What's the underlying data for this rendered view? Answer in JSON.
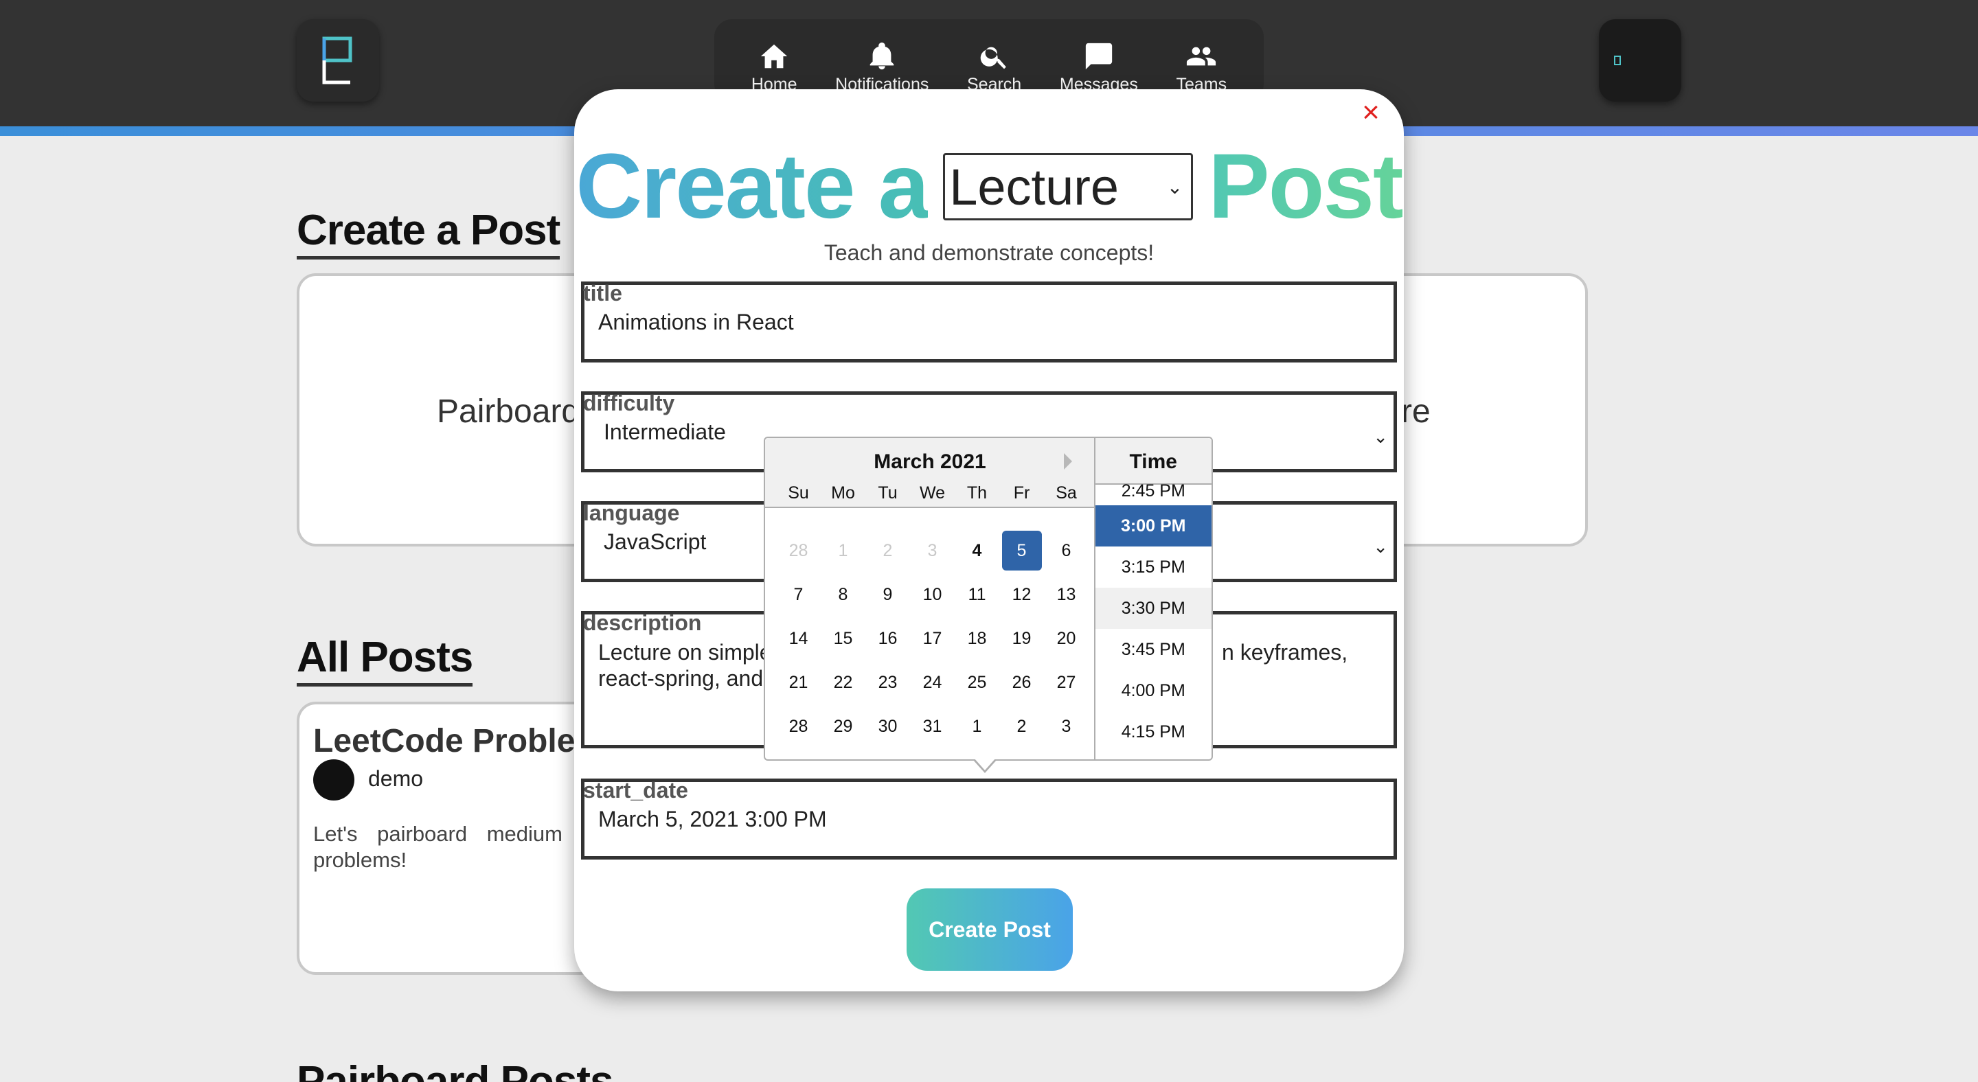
{
  "nav": {
    "items": [
      {
        "label": "Home",
        "icon": "home-icon"
      },
      {
        "label": "Notifications",
        "icon": "bell-icon"
      },
      {
        "label": "Search",
        "icon": "search-icon"
      },
      {
        "label": "Messages",
        "icon": "chat-icon"
      },
      {
        "label": "Teams",
        "icon": "people-icon"
      }
    ]
  },
  "page": {
    "create_title": "Create a Post",
    "choice_left": "Pairboard",
    "choice_right_fragment": "re",
    "all_posts_title": "All Posts",
    "pairboard_posts_title": "Pairboard Posts",
    "post_card": {
      "title": "LeetCode Problem",
      "user": "demo",
      "description": "Let's pairboard medium LeetCode problems!"
    }
  },
  "modal": {
    "close": "×",
    "title_prefix": "Create a",
    "post_type": "Lecture",
    "title_suffix": "Post",
    "subtitle": "Teach and demonstrate concepts!",
    "fields": {
      "title": {
        "label": "title",
        "value": "Animations in React"
      },
      "difficulty": {
        "label": "difficulty",
        "value": "Intermediate"
      },
      "language": {
        "label": "language",
        "value": "JavaScript"
      },
      "description": {
        "label": "description",
        "line1a": "Lecture on simple",
        "line1b": "n keyframes,",
        "line2a": "react-spring, and"
      },
      "start_date": {
        "label": "start_date",
        "value": "March 5, 2021 3:00 PM"
      }
    },
    "submit_label": "Create Post"
  },
  "datepicker": {
    "month_title": "March 2021",
    "dows": [
      "Su",
      "Mo",
      "Tu",
      "We",
      "Th",
      "Fr",
      "Sa"
    ],
    "weeks": [
      [
        "28",
        "1",
        "2",
        "3",
        "4",
        "5",
        "6"
      ],
      [
        "7",
        "8",
        "9",
        "10",
        "11",
        "12",
        "13"
      ],
      [
        "14",
        "15",
        "16",
        "17",
        "18",
        "19",
        "20"
      ],
      [
        "21",
        "22",
        "23",
        "24",
        "25",
        "26",
        "27"
      ],
      [
        "28",
        "29",
        "30",
        "31",
        "1",
        "2",
        "3"
      ]
    ],
    "time_header": "Time",
    "times": [
      "2:45 PM",
      "3:00 PM",
      "3:15 PM",
      "3:30 PM",
      "3:45 PM",
      "4:00 PM",
      "4:15 PM"
    ],
    "selected_time": "3:00 PM"
  },
  "colors": {
    "nav_bg": "#333333",
    "accent_blue": "#2f64a8",
    "brand_teal": "#52c8b3",
    "close_red": "#e0201e"
  }
}
